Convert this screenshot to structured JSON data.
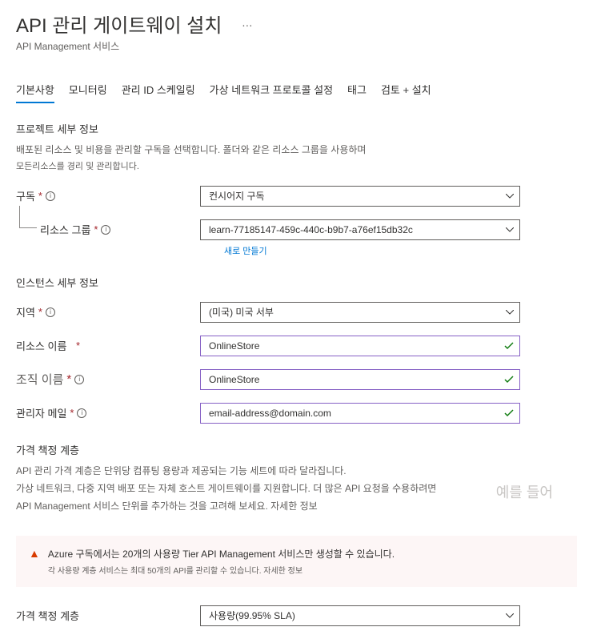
{
  "header": {
    "title": "API 관리 게이트웨이 설치",
    "subtitle": "API Management 서비스",
    "more": "…"
  },
  "tabs": {
    "basic": "기본사항",
    "monitoring": "모니터링",
    "managed_id": "관리 ID 스케일링",
    "vnet": "가상 네트워크 프로토콜 설정",
    "tags": "태그",
    "review": "검토 + 설치"
  },
  "project_details": {
    "title": "프로젝트 세부 정보",
    "desc": "배포된 리소스 및 비용을 관리할 구독을 선택합니다. 폴더와 같은 리소스 그룹을 사용하며",
    "desc_small": "모든리소스를 경리 및 관리합니다.",
    "subscription_label": "구독",
    "subscription_value": "컨시어지 구독",
    "resource_group_label": "리소스 그룹",
    "resource_group_value": "learn-77185147-459c-440c-b9b7-a76ef15db32c",
    "create_new": "새로 만들기"
  },
  "instance_details": {
    "title": "인스턴스 세부 정보",
    "region_label": "지역",
    "region_value": "(미국) 미국 서부",
    "resource_name_label": "리소스 이름",
    "resource_name_value": "OnlineStore",
    "org_name_label": "조직 이름",
    "org_name_value": "OnlineStore",
    "admin_email_label": "관리자 메일",
    "admin_email_value": "email-address@domain.com"
  },
  "pricing": {
    "title": "가격 책정 계층",
    "desc1": "API 관리 가격 계층은 단위당 컴퓨팅 용량과 제공되는 기능 세트에 따라 달라집니다.",
    "desc2": "가상 네트워크, 다중 지역 배포 또는 자체 호스트 게이트웨이를 지원합니다. 더 많은 API 요청을 수용하려면",
    "desc3": "API Management 서비스 단위를 추가하는 것을 고려해 보세요. 자세한 정보",
    "watermark": "예를 들어",
    "warning_title": "Azure 구독에서는 20개의 사용량 Tier API Management 서비스만 생성할 수 있습니다.",
    "warning_sub": "각 사용량 계층 서비스는 최대 50개의 API를 관리할 수 있습니다. 자세한 정보",
    "tier_label": "가격 책정 계층",
    "tier_value": "사용량(99.95% SLA)"
  },
  "symbols": {
    "asterisk": "*",
    "info": "i"
  }
}
